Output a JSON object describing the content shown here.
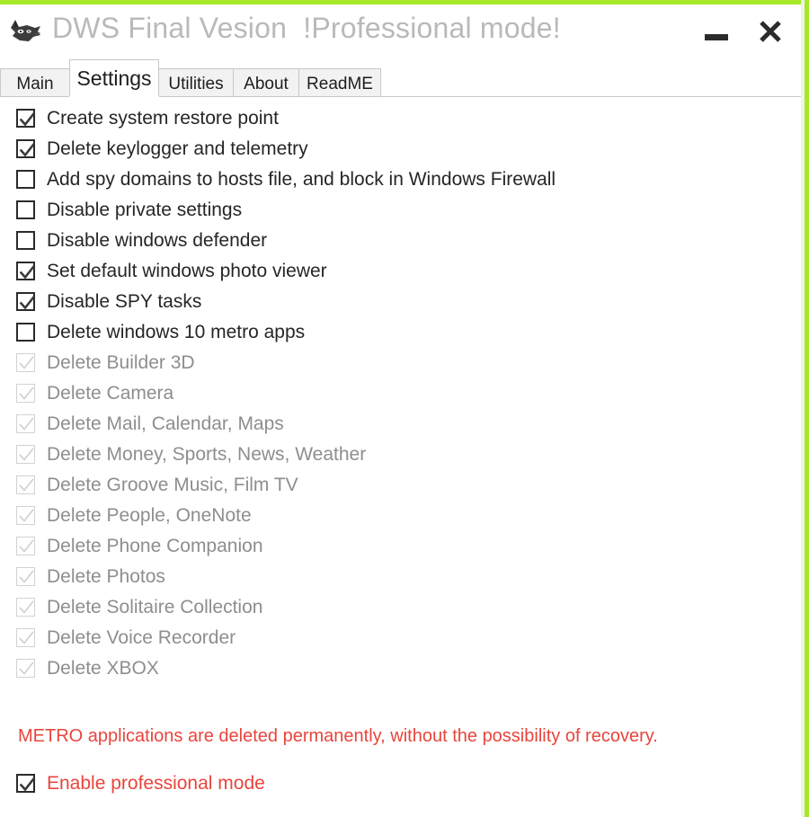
{
  "window": {
    "title": "DWS Final Vesion  !Professional mode!",
    "icon": "wolf-head-icon",
    "border_color": "#a6e82a",
    "controls": {
      "minimize_label": "—",
      "close_label": "✕"
    }
  },
  "tabs": [
    {
      "label": "Main",
      "active": false
    },
    {
      "label": "Settings",
      "active": true
    },
    {
      "label": "Utilities",
      "active": false
    },
    {
      "label": "About",
      "active": false
    },
    {
      "label": "ReadME",
      "active": false
    }
  ],
  "settings": {
    "options": [
      {
        "label": "Create system restore point",
        "checked": true,
        "enabled": true
      },
      {
        "label": "Delete keylogger and telemetry",
        "checked": true,
        "enabled": true
      },
      {
        "label": "Add spy domains to hosts file, and block in Windows Firewall",
        "checked": false,
        "enabled": true
      },
      {
        "label": "Disable private settings",
        "checked": false,
        "enabled": true
      },
      {
        "label": "Disable windows defender",
        "checked": false,
        "enabled": true
      },
      {
        "label": "Set default windows photo viewer",
        "checked": true,
        "enabled": true
      },
      {
        "label": "Disable SPY tasks",
        "checked": true,
        "enabled": true
      },
      {
        "label": "Delete windows 10 metro apps",
        "checked": false,
        "enabled": true
      },
      {
        "label": "Delete Builder 3D",
        "checked": true,
        "enabled": false
      },
      {
        "label": "Delete Camera",
        "checked": true,
        "enabled": false
      },
      {
        "label": "Delete Mail, Calendar, Maps",
        "checked": true,
        "enabled": false
      },
      {
        "label": "Delete Money, Sports, News, Weather",
        "checked": true,
        "enabled": false
      },
      {
        "label": "Delete Groove Music, Film TV",
        "checked": true,
        "enabled": false
      },
      {
        "label": "Delete People, OneNote",
        "checked": true,
        "enabled": false
      },
      {
        "label": "Delete Phone Companion",
        "checked": true,
        "enabled": false
      },
      {
        "label": "Delete Photos",
        "checked": true,
        "enabled": false
      },
      {
        "label": "Delete Solitaire Collection",
        "checked": true,
        "enabled": false
      },
      {
        "label": "Delete Voice Recorder",
        "checked": true,
        "enabled": false
      },
      {
        "label": "Delete XBOX",
        "checked": true,
        "enabled": false
      }
    ],
    "warning": {
      "text": "METRO applications are deleted permanently, without the possibility of recovery.",
      "color": "#e8453c"
    },
    "professional_mode": {
      "label": "Enable professional mode",
      "checked": true,
      "color": "#e8453c"
    }
  }
}
